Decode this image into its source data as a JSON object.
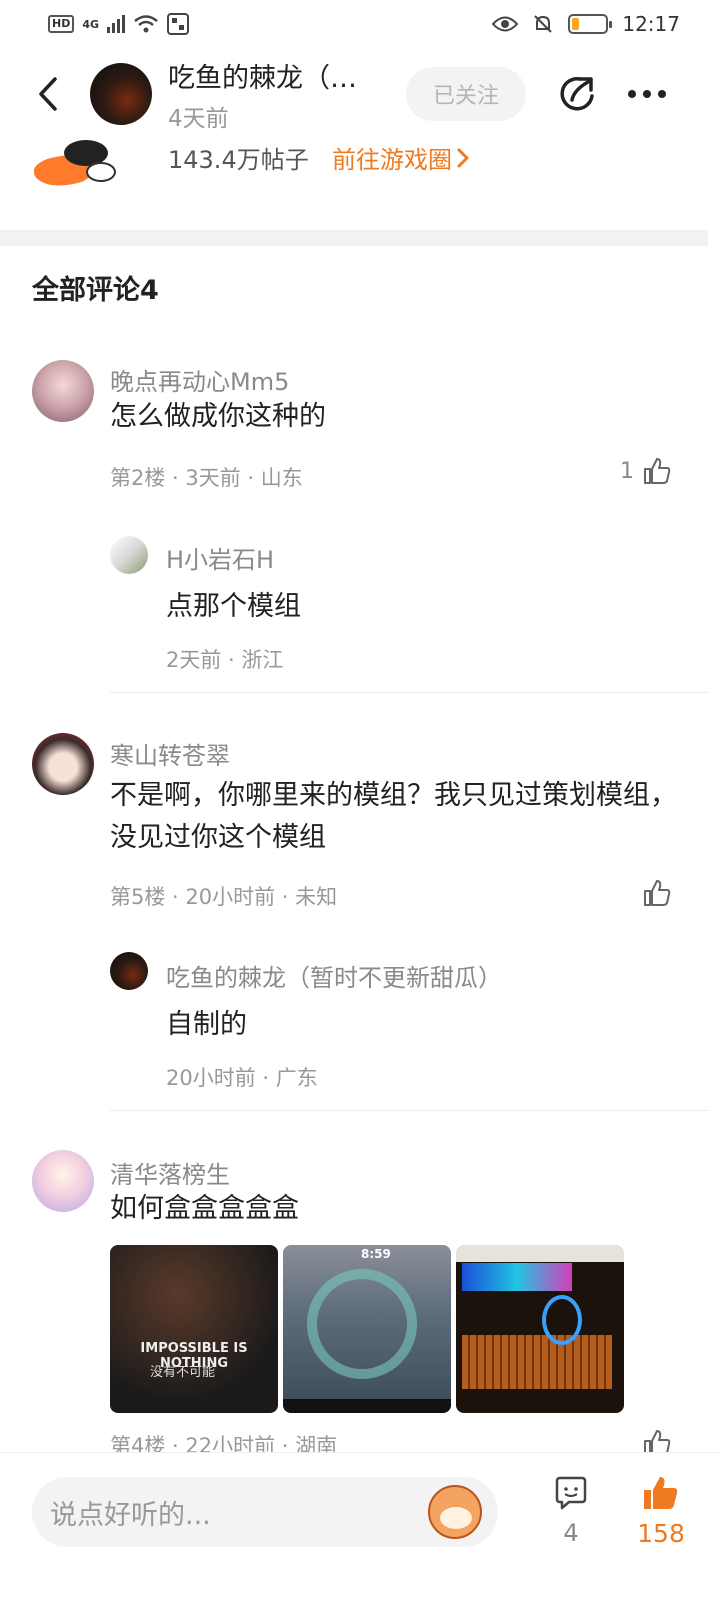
{
  "status_bar": {
    "left_chips": [
      "HD",
      "4G"
    ],
    "right_time": "12:17",
    "battery_level": 0.2
  },
  "header": {
    "author_name": "吃鱼的棘龙（…",
    "time": "4天前",
    "follow_label": "已关注"
  },
  "game_circle": {
    "post_count": "143.4万帖子",
    "go_label": "前往游戏圈"
  },
  "comments_section": {
    "title": "全部评论4"
  },
  "comments": [
    {
      "name": "晚点再动心Mm5",
      "text": "怎么做成你这种的",
      "meta": "第2楼 · 3天前 · 山东",
      "likes": "1",
      "reply": {
        "name": "H小岩石H",
        "text": "点那个模组",
        "meta": "2天前 · 浙江"
      }
    },
    {
      "name": "寒山转苍翠",
      "text": "不是啊，你哪里来的模组？我只见过策划模组，没见过你这个模组",
      "meta": "第5楼 · 20小时前 · 未知",
      "likes": "",
      "reply": {
        "name": "吃鱼的棘龙（暂时不更新甜瓜）",
        "text": "自制的",
        "meta": "20小时前 · 广东"
      }
    },
    {
      "name": "清华落榜生",
      "text": "如何盒盒盒盒盒",
      "meta": "第4楼 · 22小时前 · 湖南",
      "likes": "",
      "images": [
        {
          "caption": "IMPOSSIBLE IS NOTHING",
          "sub": "没有不可能"
        },
        {
          "caption": "8:59"
        },
        {
          "caption": ""
        }
      ]
    }
  ],
  "bottom_bar": {
    "input_placeholder": "说点好听的...",
    "comment_count": "4",
    "like_count": "158"
  },
  "colors": {
    "accent": "#f07a20",
    "muted_text": "#999999",
    "divider": "#f2f2f2"
  }
}
